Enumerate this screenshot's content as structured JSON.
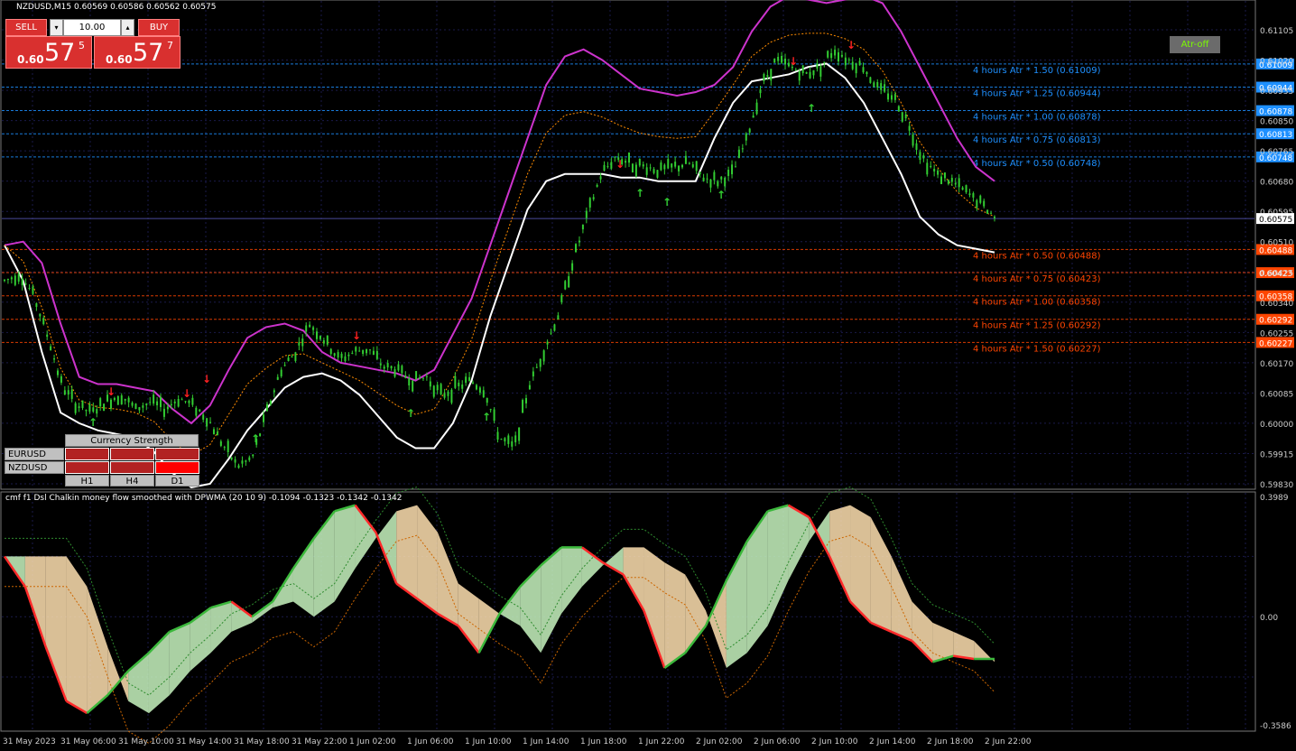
{
  "window": {
    "title": "NZDUSD,M15  0.60569 0.60586 0.60562 0.60575",
    "indicator_title": "cmf f1 Dsl Chalkin money flow smoothed with DPWMA (20 10 9) -0.1094 -0.1323 -0.1342 -0.1342"
  },
  "trade_panel": {
    "sell_label": "SELL",
    "buy_label": "BUY",
    "lot_value": "10.00",
    "spin_down": "▾",
    "spin_up": "▴",
    "sell_price": {
      "prefix": "0.60",
      "big": "57",
      "sup": "5"
    },
    "buy_price": {
      "prefix": "0.60",
      "big": "57",
      "sup": "7"
    }
  },
  "atr_button": "Atr-off",
  "atr_levels": {
    "upper": [
      {
        "label": "4 hours Atr * 1.50 (0.61009)",
        "tag": "0.61009"
      },
      {
        "label": "4 hours Atr * 1.25 (0.60944)",
        "tag": "0.60944"
      },
      {
        "label": "4 hours Atr * 1.00 (0.60878)",
        "tag": "0.60878"
      },
      {
        "label": "4 hours Atr * 0.75 (0.60813)",
        "tag": "0.60813"
      },
      {
        "label": "4 hours Atr * 0.50 (0.60748)",
        "tag": "0.60748"
      }
    ],
    "lower": [
      {
        "label": "4 hours Atr * 0.50 (0.60488)",
        "tag": "0.60488"
      },
      {
        "label": "4 hours Atr * 0.75 (0.60423)",
        "tag": "0.60423"
      },
      {
        "label": "4 hours Atr * 1.00 (0.60358)",
        "tag": "0.60358"
      },
      {
        "label": "4 hours Atr * 1.25 (0.60292)",
        "tag": "0.60292"
      },
      {
        "label": "4 hours Atr * 1.50 (0.60227)",
        "tag": "0.60227"
      }
    ]
  },
  "current_price_tag": "0.60575",
  "price_axis": [
    "0.61105",
    "0.61020",
    "0.60935",
    "0.60850",
    "0.60765",
    "0.60680",
    "0.60595",
    "0.60510",
    "0.60425",
    "0.60340",
    "0.60255",
    "0.60170",
    "0.60085",
    "0.60000",
    "0.59915",
    "0.59830"
  ],
  "indicator_axis": [
    "0.3989",
    "0.00",
    "-0.3586"
  ],
  "time_axis": [
    "31 May 2023",
    "31 May 06:00",
    "31 May 10:00",
    "31 May 14:00",
    "31 May 18:00",
    "31 May 22:00",
    "1 Jun 02:00",
    "1 Jun 06:00",
    "1 Jun 10:00",
    "1 Jun 14:00",
    "1 Jun 18:00",
    "1 Jun 22:00",
    "2 Jun 02:00",
    "2 Jun 06:00",
    "2 Jun 10:00",
    "2 Jun 14:00",
    "2 Jun 18:00",
    "2 Jun 22:00"
  ],
  "currency_strength": {
    "title": "Currency Strength",
    "rows": [
      {
        "pair": "EURUSD",
        "cells": [
          "#b22222",
          "#b22222",
          "#b22222"
        ]
      },
      {
        "pair": "NZDUSD",
        "cells": [
          "#b22222",
          "#b22222",
          "#ff0000"
        ]
      }
    ],
    "timeframes": [
      "H1",
      "H4",
      "D1"
    ]
  },
  "colors": {
    "background": "#000000",
    "grid": "#1a1a4a",
    "candle": "#32cd32",
    "upper_band": "#cc33cc",
    "lower_band": "#ffffff",
    "atr_upper": "#1e90ff",
    "atr_lower": "#ff4500",
    "trade_red": "#d9302f"
  },
  "chart_data": {
    "type": "line",
    "symbol": "NZDUSD",
    "timeframe": "M15",
    "ylim": [
      0.5983,
      0.6112
    ],
    "price_close": [
      0.604,
      0.6042,
      0.6036,
      0.6024,
      0.601,
      0.6005,
      0.6003,
      0.6006,
      0.6008,
      0.6004,
      0.6006,
      0.6004,
      0.6007,
      0.6005,
      0.6001,
      0.5994,
      0.5988,
      0.599,
      0.6003,
      0.6015,
      0.602,
      0.6028,
      0.6023,
      0.6018,
      0.602,
      0.6021,
      0.6016,
      0.6015,
      0.6012,
      0.6013,
      0.6008,
      0.601,
      0.6012,
      0.6009,
      0.5996,
      0.5993,
      0.601,
      0.602,
      0.603,
      0.6045,
      0.6058,
      0.607,
      0.6075,
      0.6073,
      0.6072,
      0.6071,
      0.6072,
      0.6073,
      0.6069,
      0.6068,
      0.607,
      0.608,
      0.6095,
      0.6102,
      0.61,
      0.6098,
      0.61,
      0.6105,
      0.6102,
      0.61,
      0.6094,
      0.6092,
      0.6085,
      0.6075,
      0.607,
      0.6068,
      0.6065,
      0.6062,
      0.6058
    ],
    "upper_band": [
      0.605,
      0.6051,
      0.6045,
      0.6028,
      0.6013,
      0.6011,
      0.6011,
      0.601,
      0.6009,
      0.6004,
      0.6,
      0.6005,
      0.6015,
      0.6024,
      0.6027,
      0.6028,
      0.6026,
      0.602,
      0.6017,
      0.6016,
      0.6015,
      0.6014,
      0.6012,
      0.6015,
      0.6025,
      0.6035,
      0.605,
      0.6065,
      0.608,
      0.6095,
      0.6103,
      0.6105,
      0.6102,
      0.6098,
      0.6094,
      0.6093,
      0.6092,
      0.6093,
      0.6095,
      0.61,
      0.611,
      0.6117,
      0.612,
      0.6119,
      0.6118,
      0.6119,
      0.612,
      0.6118,
      0.611,
      0.61,
      0.609,
      0.608,
      0.6072,
      0.6068
    ],
    "lower_band": [
      0.605,
      0.604,
      0.602,
      0.6003,
      0.6,
      0.5998,
      0.5997,
      0.5996,
      0.5992,
      0.5986,
      0.5982,
      0.5983,
      0.599,
      0.5998,
      0.6004,
      0.601,
      0.6013,
      0.6014,
      0.6012,
      0.6008,
      0.6002,
      0.5996,
      0.5993,
      0.5993,
      0.6,
      0.6012,
      0.603,
      0.6045,
      0.606,
      0.6068,
      0.607,
      0.607,
      0.607,
      0.6069,
      0.6069,
      0.6068,
      0.6068,
      0.6068,
      0.608,
      0.609,
      0.6096,
      0.6097,
      0.6098,
      0.61,
      0.6101,
      0.6097,
      0.609,
      0.608,
      0.607,
      0.6058,
      0.6053,
      0.605,
      0.6049,
      0.6048
    ],
    "indicator_ylim": [
      -0.3586,
      0.3989
    ],
    "indicator_main": [
      0.2,
      0.1,
      -0.1,
      -0.28,
      -0.32,
      -0.26,
      -0.18,
      -0.12,
      -0.05,
      -0.02,
      0.03,
      0.05,
      0.0,
      0.05,
      0.16,
      0.26,
      0.35,
      0.37,
      0.28,
      0.11,
      0.06,
      0.01,
      -0.03,
      -0.12,
      0.01,
      0.1,
      0.17,
      0.23,
      0.23,
      0.18,
      0.14,
      0.02,
      -0.17,
      -0.12,
      -0.03,
      0.12,
      0.25,
      0.35,
      0.37,
      0.33,
      0.2,
      0.05,
      -0.02,
      -0.05,
      -0.08,
      -0.15,
      -0.13,
      -0.14,
      -0.14
    ]
  }
}
